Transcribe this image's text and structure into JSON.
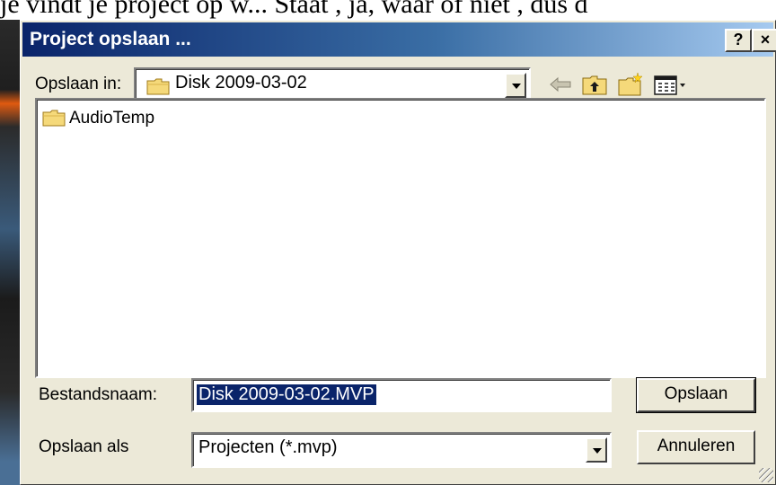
{
  "background": {
    "text": "je vindt je project op w... Staat , ja, waar of niet , dus d"
  },
  "dialog": {
    "title": "Project opslaan ...",
    "help_label": "?",
    "close_label": "×"
  },
  "save_in": {
    "label": "Opslaan in:",
    "value": "Disk 2009-03-02"
  },
  "toolbar": {
    "icons": [
      "back-arrow-icon",
      "up-folder-icon",
      "new-folder-icon",
      "view-menu-icon"
    ]
  },
  "file_list": {
    "items": [
      {
        "name": "AudioTemp",
        "icon": "folder-icon"
      }
    ]
  },
  "filename": {
    "label": "Bestandsnaam:",
    "value": "Disk 2009-03-02.MVP"
  },
  "save_as": {
    "label": "Opslaan als",
    "value": "Projecten (*.mvp)"
  },
  "buttons": {
    "save": "Opslaan",
    "cancel": "Annuleren"
  },
  "colors": {
    "title_bar_start": "#0a246a",
    "title_bar_end": "#a6caf0",
    "dialog_face": "#ece9d8",
    "selection": "#0a246a"
  }
}
